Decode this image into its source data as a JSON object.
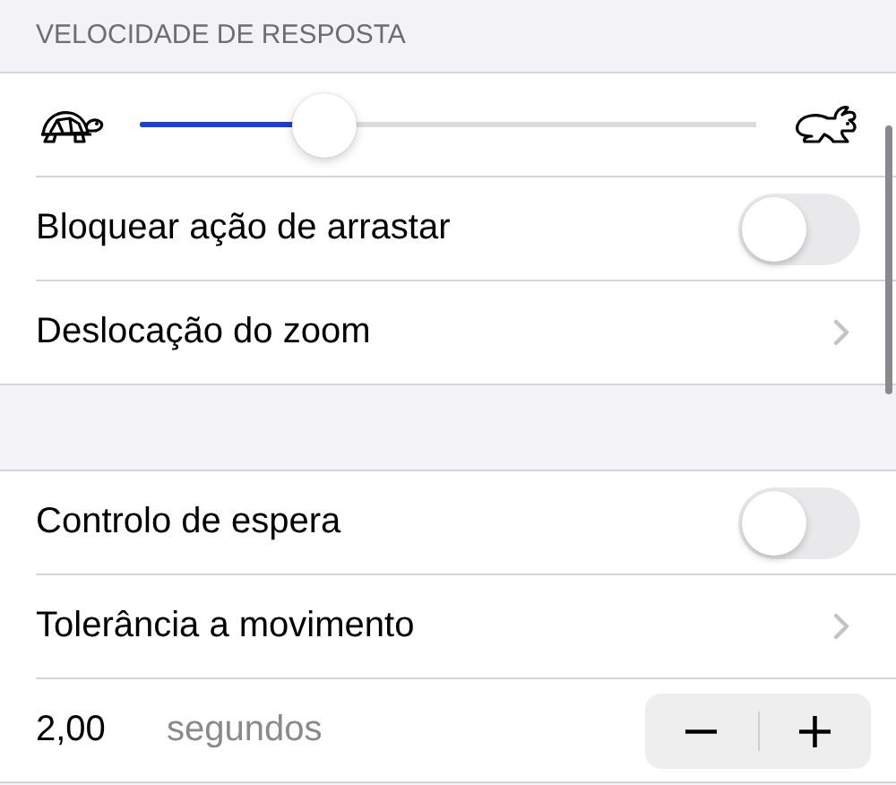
{
  "section_header": "VELOCIDADE DE RESPOSTA",
  "groups": [
    {
      "rows": [
        {
          "kind": "slider",
          "level": 0.3
        },
        {
          "kind": "toggle",
          "label": "Bloquear ação de arrastar",
          "on": false
        },
        {
          "kind": "link",
          "label": "Deslocação do zoom"
        }
      ]
    },
    {
      "rows": [
        {
          "kind": "toggle",
          "label": "Controlo de espera",
          "on": false
        },
        {
          "kind": "link",
          "label": "Tolerância a movimento"
        },
        {
          "kind": "stepper",
          "value": "2,00",
          "unit": "segundos",
          "minus": "−",
          "plus": "+"
        }
      ]
    }
  ]
}
